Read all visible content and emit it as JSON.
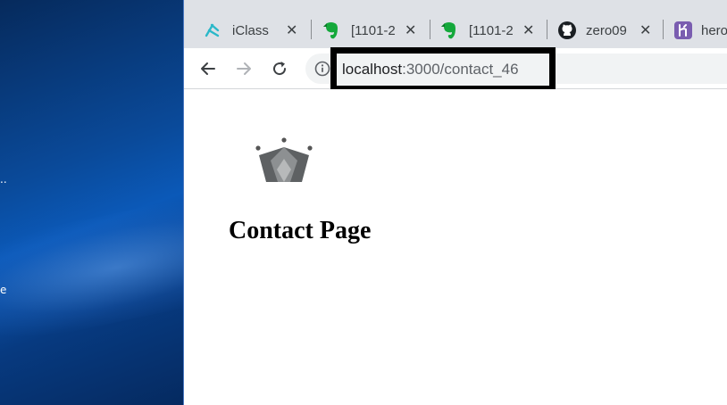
{
  "desktop": {
    "labels": [
      "..",
      "e"
    ]
  },
  "tabs": [
    {
      "label": "iClass",
      "icon": "iclass-icon",
      "accent": "#2bb8c9"
    },
    {
      "label": "[1101-2",
      "icon": "evernote-icon",
      "accent": "#14a83b"
    },
    {
      "label": "[1101-2",
      "icon": "evernote-icon",
      "accent": "#14a83b"
    },
    {
      "label": "zero09",
      "icon": "github-icon",
      "accent": "#1b1f23"
    },
    {
      "label": "hero",
      "icon": "heroku-icon",
      "accent": "#7a5db0"
    }
  ],
  "address_bar": {
    "host": "localhost",
    "path": ":3000/contact_46"
  },
  "page": {
    "title": "Contact Page",
    "logo_icon": "crown-icon"
  }
}
